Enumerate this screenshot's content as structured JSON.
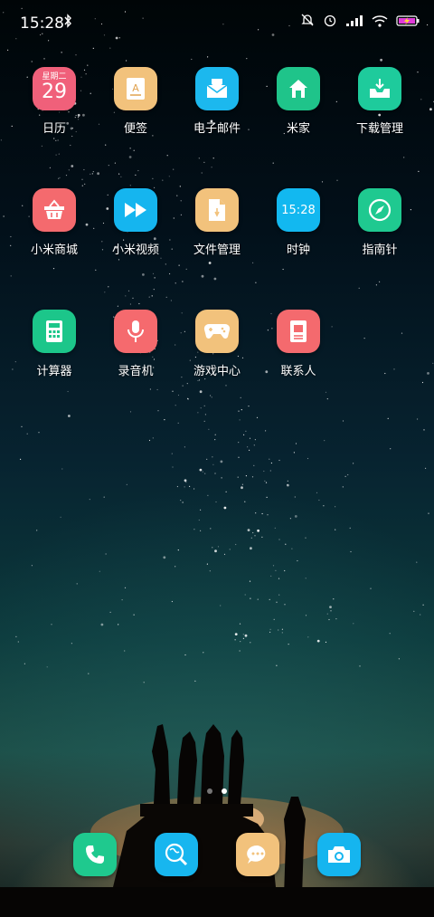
{
  "status_bar": {
    "time": "15:28",
    "icons": [
      "bluetooth-icon",
      "mute-icon",
      "alarm-icon",
      "signal-icon",
      "wifi-icon",
      "battery-charging-icon"
    ]
  },
  "calendar": {
    "weekday": "星期二",
    "date": "29"
  },
  "clock_widget_time": "15:28",
  "apps": [
    {
      "label": "日历",
      "icon": "calendar-icon",
      "color": "#f0607a"
    },
    {
      "label": "便签",
      "icon": "notes-icon",
      "color": "#f2c27c"
    },
    {
      "label": "电子邮件",
      "icon": "email-icon",
      "color": "#1cb8ee"
    },
    {
      "label": "米家",
      "icon": "home-icon",
      "color": "#1fc48a"
    },
    {
      "label": "下载管理",
      "icon": "download-icon",
      "color": "#1ecb9c"
    },
    {
      "label": "小米商城",
      "icon": "shop-basket-icon",
      "color": "#f46a6e"
    },
    {
      "label": "小米视频",
      "icon": "video-play-icon",
      "color": "#15b5ef"
    },
    {
      "label": "文件管理",
      "icon": "file-icon",
      "color": "#f2c27c"
    },
    {
      "label": "时钟",
      "icon": "clock-icon",
      "color": "#12b8f0"
    },
    {
      "label": "指南针",
      "icon": "compass-icon",
      "color": "#1fc990"
    },
    {
      "label": "计算器",
      "icon": "calculator-icon",
      "color": "#1cc68a"
    },
    {
      "label": "录音机",
      "icon": "microphone-icon",
      "color": "#f56a6e"
    },
    {
      "label": "游戏中心",
      "icon": "gamepad-icon",
      "color": "#f2c27c"
    },
    {
      "label": "联系人",
      "icon": "contacts-icon",
      "color": "#f46a6e"
    }
  ],
  "dock": [
    {
      "icon": "phone-icon",
      "color": "#1fc98e"
    },
    {
      "icon": "browser-icon",
      "color": "#17b6ef"
    },
    {
      "icon": "messages-icon",
      "color": "#f2c27c"
    },
    {
      "icon": "camera-icon",
      "color": "#15b5ef"
    }
  ],
  "page_indicator": {
    "pages": 2,
    "active": 2
  }
}
